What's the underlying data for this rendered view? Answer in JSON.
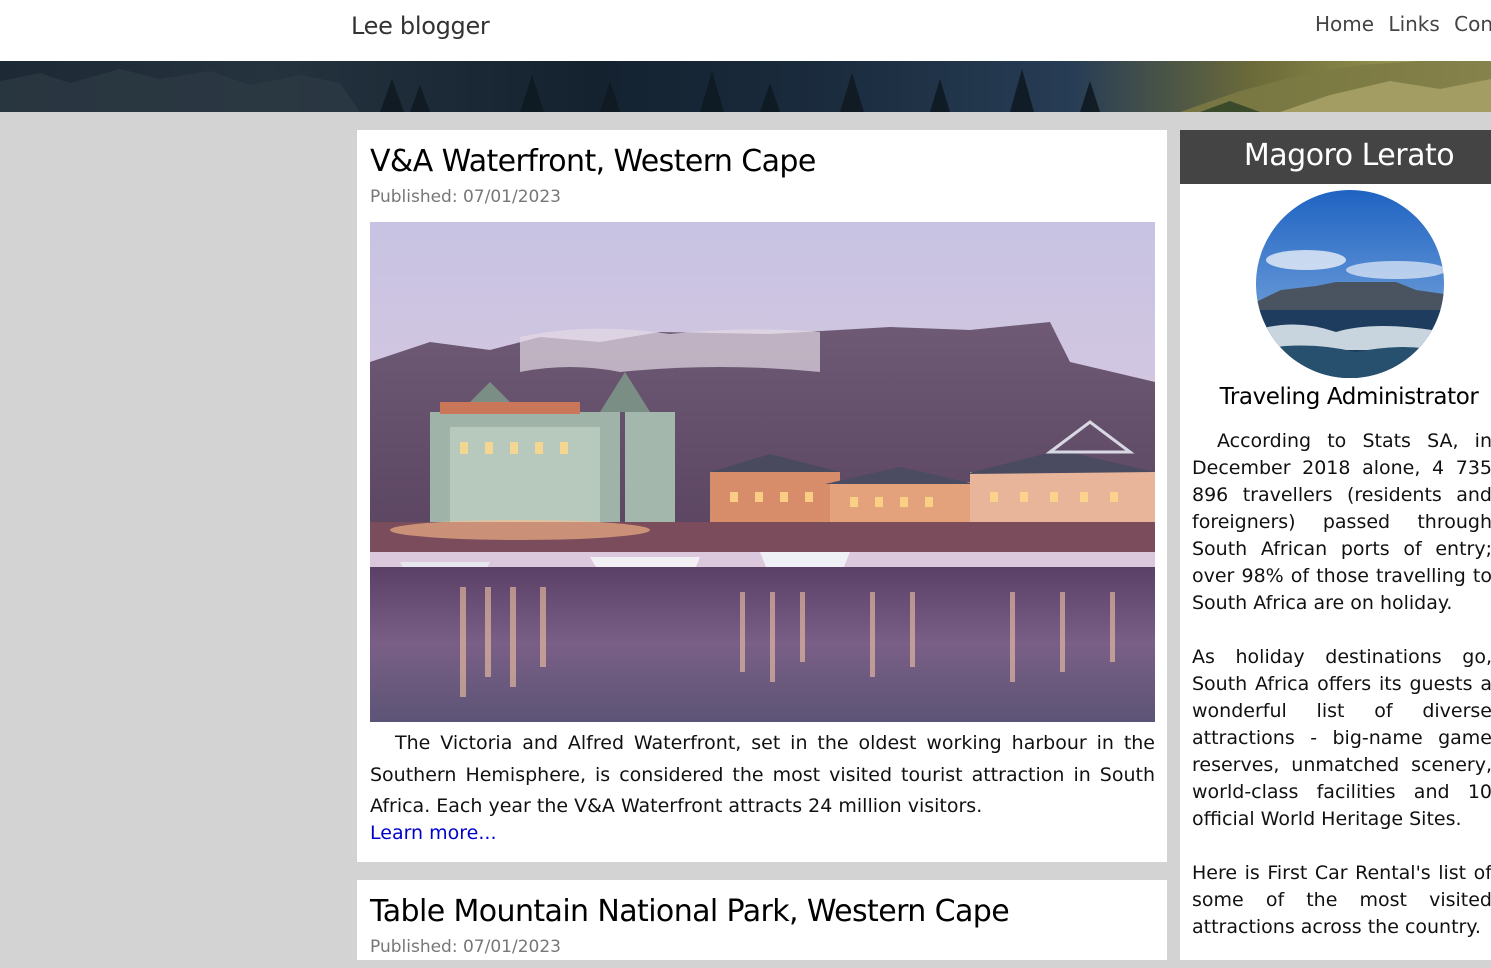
{
  "header": {
    "brand": "Lee blogger",
    "nav": [
      "Home",
      "Links",
      "Contact"
    ]
  },
  "posts": [
    {
      "title": "V&A Waterfront, Western Cape",
      "published": "Published: 07/01/2023",
      "image": "waterfront-harbour-photo",
      "text": "The Victoria and Alfred Waterfront, set in the oldest working harbour in the Southern Hemisphere, is considered the most visited tourist attraction in South Africa. Each year the V&A Waterfront attracts 24 million visitors.",
      "link": "Learn more..."
    },
    {
      "title": "Table Mountain National Park, Western Cape",
      "published": "Published: 07/01/2023"
    }
  ],
  "sidebar": {
    "name": "Magoro Lerato",
    "avatar": "table-mountain-avatar",
    "role": "Traveling Administrator",
    "paragraphs": [
      "According to Stats SA, in December 2018 alone, 4 735 896 travellers (residents and foreigners) passed through South African ports of entry; over 98% of those travelling to South Africa are on holiday.",
      "As holiday destinations go, South Africa offers its guests a wonderful list of diverse attractions - big-name game reserves, unmatched scenery, world-class facilities and 10 official World Heritage Sites.",
      "Here is First Car Rental's list of some of the most visited attractions across the country."
    ]
  },
  "colors": {
    "page_background": "#d3d3d3",
    "sidebar_header": "#444444",
    "link": "#0000cc"
  }
}
